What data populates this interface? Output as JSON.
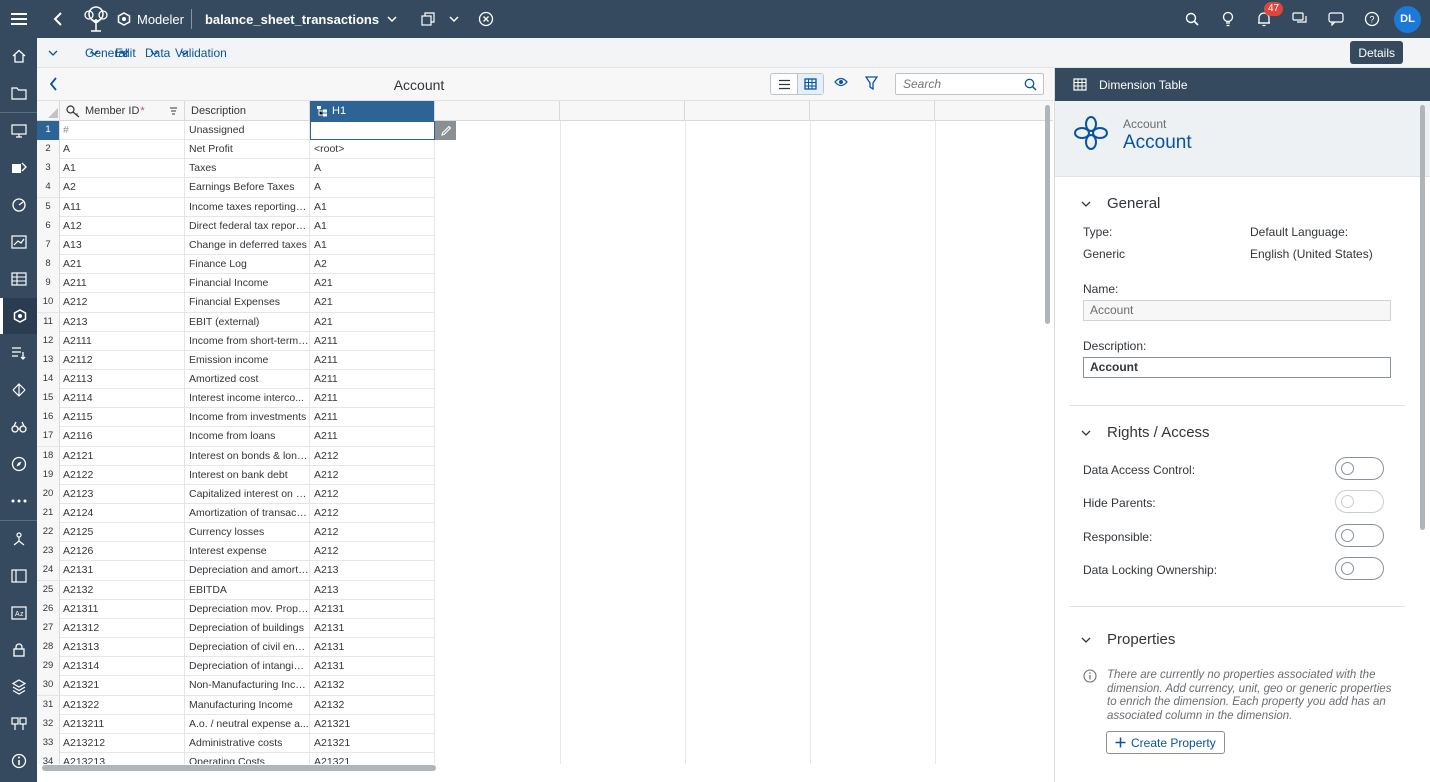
{
  "shell": {
    "app_name": "Modeler",
    "document_title": "balance_sheet_transactions",
    "notification_count": "47",
    "user_initials": "DL"
  },
  "menu": {
    "general": "General",
    "edit": "Edit",
    "data": "Data",
    "validation": "Validation",
    "details": "Details"
  },
  "grid": {
    "title": "Account",
    "search_placeholder": "Search",
    "columns": {
      "member_id": "Member ID",
      "required_marker": "*",
      "description": "Description",
      "hierarchy": "H1"
    },
    "rows": [
      {
        "n": "1",
        "id": "#",
        "desc": "Unassigned",
        "h1": ""
      },
      {
        "n": "2",
        "id": "A",
        "desc": "Net Profit",
        "h1": "<root>"
      },
      {
        "n": "3",
        "id": "A1",
        "desc": "Taxes",
        "h1": "A"
      },
      {
        "n": "4",
        "id": "A2",
        "desc": "Earnings Before Taxes",
        "h1": "A"
      },
      {
        "n": "5",
        "id": "A11",
        "desc": "Income taxes reporting y...",
        "h1": "A1"
      },
      {
        "n": "6",
        "id": "A12",
        "desc": "Direct federal tax reporti...",
        "h1": "A1"
      },
      {
        "n": "7",
        "id": "A13",
        "desc": "Change in deferred taxes",
        "h1": "A1"
      },
      {
        "n": "8",
        "id": "A21",
        "desc": "Finance Log",
        "h1": "A2"
      },
      {
        "n": "9",
        "id": "A211",
        "desc": "Financial Income",
        "h1": "A21"
      },
      {
        "n": "10",
        "id": "A212",
        "desc": "Financial Expenses",
        "h1": "A21"
      },
      {
        "n": "11",
        "id": "A213",
        "desc": "EBIT (external)",
        "h1": "A21"
      },
      {
        "n": "12",
        "id": "A2111",
        "desc": "Income from short-term ...",
        "h1": "A211"
      },
      {
        "n": "13",
        "id": "A2112",
        "desc": "Emission income",
        "h1": "A211"
      },
      {
        "n": "14",
        "id": "A2113",
        "desc": "Amortized cost",
        "h1": "A211"
      },
      {
        "n": "15",
        "id": "A2114",
        "desc": "Interest income interco...",
        "h1": "A211"
      },
      {
        "n": "16",
        "id": "A2115",
        "desc": "Income from investments",
        "h1": "A211"
      },
      {
        "n": "17",
        "id": "A2116",
        "desc": "Income from loans",
        "h1": "A211"
      },
      {
        "n": "18",
        "id": "A2121",
        "desc": "Interest on bonds & long...",
        "h1": "A212"
      },
      {
        "n": "19",
        "id": "A2122",
        "desc": "Interest on bank debt",
        "h1": "A212"
      },
      {
        "n": "20",
        "id": "A2123",
        "desc": "Capitalized interest on b...",
        "h1": "A212"
      },
      {
        "n": "21",
        "id": "A2124",
        "desc": "Amortization of transacti...",
        "h1": "A212"
      },
      {
        "n": "22",
        "id": "A2125",
        "desc": "Currency losses",
        "h1": "A212"
      },
      {
        "n": "23",
        "id": "A2126",
        "desc": "Interest expense",
        "h1": "A212"
      },
      {
        "n": "24",
        "id": "A2131",
        "desc": "Depreciation and amorti...",
        "h1": "A213"
      },
      {
        "n": "25",
        "id": "A2132",
        "desc": "EBITDA",
        "h1": "A213"
      },
      {
        "n": "26",
        "id": "A21311",
        "desc": "Depreciation mov. Prope...",
        "h1": "A2131"
      },
      {
        "n": "27",
        "id": "A21312",
        "desc": "Depreciation of buildings",
        "h1": "A2131"
      },
      {
        "n": "28",
        "id": "A21313",
        "desc": "Depreciation of civil engi...",
        "h1": "A2131"
      },
      {
        "n": "29",
        "id": "A21314",
        "desc": "Depreciation of intangibl...",
        "h1": "A2131"
      },
      {
        "n": "30",
        "id": "A21321",
        "desc": "Non-Manufacturing Inco...",
        "h1": "A2132"
      },
      {
        "n": "31",
        "id": "A21322",
        "desc": "Manufacturing Income",
        "h1": "A2132"
      },
      {
        "n": "32",
        "id": "A213211",
        "desc": "A.o. / neutral expense a...",
        "h1": "A21321"
      },
      {
        "n": "33",
        "id": "A213212",
        "desc": "Administrative costs",
        "h1": "A21321"
      },
      {
        "n": "34",
        "id": "A213213",
        "desc": "Operating Costs",
        "h1": "A21321"
      }
    ]
  },
  "panel": {
    "header": "Dimension Table",
    "dimension_sub": "Account",
    "dimension_name": "Account",
    "general": {
      "title": "General",
      "type_label": "Type:",
      "type_value": "Generic",
      "language_label": "Default Language:",
      "language_value": "English (United States)",
      "name_label": "Name:",
      "name_value": "Account",
      "description_label": "Description:",
      "description_value": "Account"
    },
    "rights": {
      "title": "Rights / Access",
      "data_access": "Data Access Control:",
      "hide_parents": "Hide Parents:",
      "responsible": "Responsible:",
      "data_locking": "Data Locking Ownership:"
    },
    "properties": {
      "title": "Properties",
      "info": "There are currently no properties associated with the dimension. Add currency, unit, geo or generic properties to enrich the dimension. Each property you add has an associated column in the dimension.",
      "create_button": "Create Property"
    }
  },
  "colors": {
    "shell": "#354a5f",
    "accent": "#0854a0",
    "selected_column": "#2d6496",
    "badge": "#e0453c",
    "avatar": "#1a7ad6"
  }
}
